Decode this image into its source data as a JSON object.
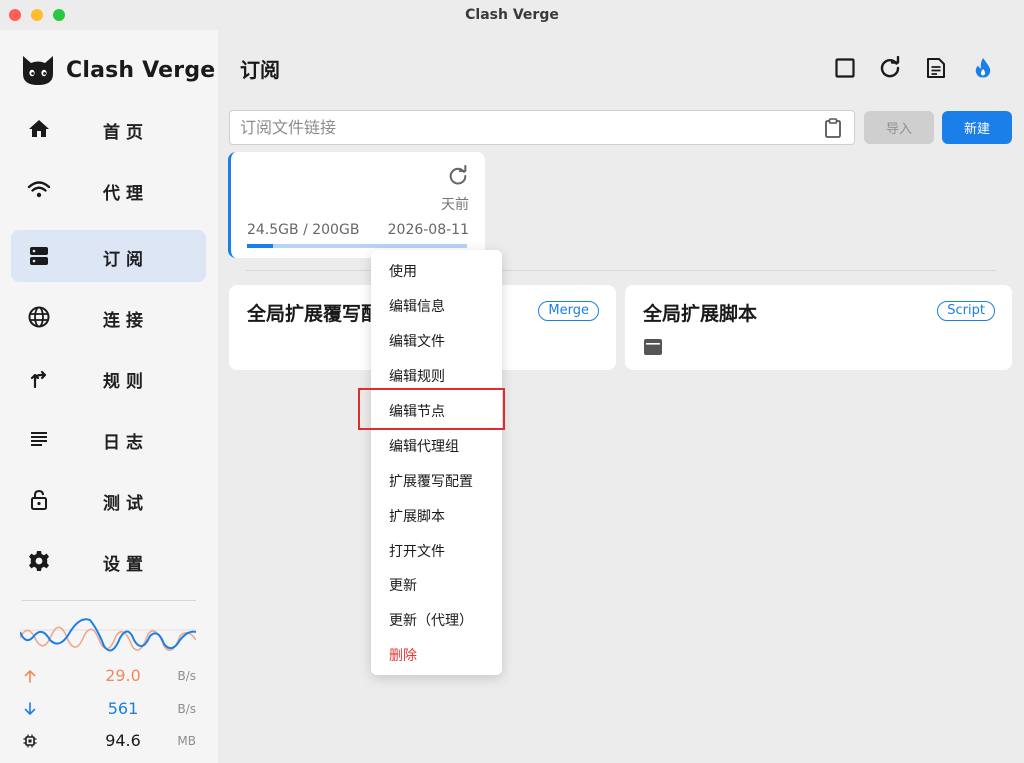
{
  "window": {
    "title": "Clash Verge"
  },
  "app": {
    "name": "Clash Verge"
  },
  "sidebar": {
    "items": [
      {
        "label": "首页",
        "icon": "home-icon",
        "active": false
      },
      {
        "label": "代理",
        "icon": "wifi-icon",
        "active": false
      },
      {
        "label": "订阅",
        "icon": "dns-icon",
        "active": true
      },
      {
        "label": "连接",
        "icon": "globe-icon",
        "active": false
      },
      {
        "label": "规则",
        "icon": "fork-icon",
        "active": false
      },
      {
        "label": "日志",
        "icon": "list-icon",
        "active": false
      },
      {
        "label": "测试",
        "icon": "lock-icon",
        "active": false
      },
      {
        "label": "设置",
        "icon": "gear-icon",
        "active": false
      }
    ],
    "traffic": {
      "upload": {
        "value": "29.0",
        "unit": "B/s",
        "color": "#f08a5d"
      },
      "download": {
        "value": "561",
        "unit": "B/s",
        "color": "#1a7fe8"
      },
      "memory": {
        "value": "94.6",
        "unit": "MB"
      }
    }
  },
  "header": {
    "title": "订阅",
    "icons": [
      "square-icon",
      "refresh-icon",
      "document-icon",
      "fire-icon"
    ]
  },
  "search": {
    "placeholder": "订阅文件链接"
  },
  "buttons": {
    "import": "导入",
    "new": "新建"
  },
  "profile": {
    "updated_ago": "天前",
    "usage": "24.5GB / 200GB",
    "expire": "2026-08-11",
    "usage_fraction": 0.12
  },
  "ext_cards": [
    {
      "title": "全局扩展覆写配置",
      "badge": "Merge"
    },
    {
      "title": "全局扩展脚本",
      "badge": "Script"
    }
  ],
  "context_menu": {
    "items": [
      {
        "label": "使用"
      },
      {
        "label": "编辑信息"
      },
      {
        "label": "编辑文件"
      },
      {
        "label": "编辑规则"
      },
      {
        "label": "编辑节点"
      },
      {
        "label": "编辑代理组"
      },
      {
        "label": "扩展覆写配置"
      },
      {
        "label": "扩展脚本"
      },
      {
        "label": "打开文件"
      },
      {
        "label": "更新"
      },
      {
        "label": "更新（代理）"
      },
      {
        "label": "删除",
        "danger": true
      }
    ]
  },
  "colors": {
    "accent": "#1a7fe8",
    "active_nav_bg": "#dde6f4",
    "danger": "#e53935",
    "highlight": "#d9302f"
  }
}
